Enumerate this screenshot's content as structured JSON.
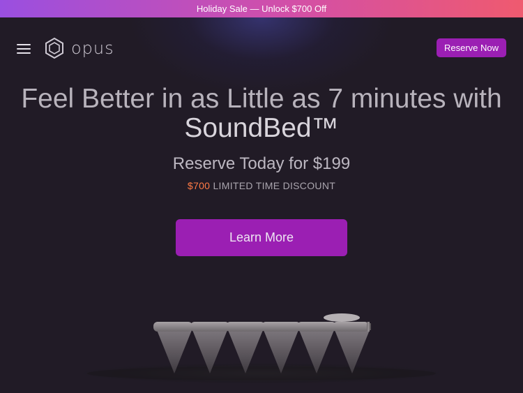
{
  "promo": {
    "text": "Holiday Sale — Unlock $700 Off"
  },
  "header": {
    "logo_text": "opus",
    "reserve_label": "Reserve Now"
  },
  "hero": {
    "headline_line1": "Feel Better in as Little as 7 minutes with",
    "headline_brand": "SoundBed™",
    "subhead": "Reserve Today for $199",
    "discount_price": "$700",
    "discount_text": " LIMITED TIME DISCOUNT",
    "cta_label": "Learn More"
  },
  "colors": {
    "accent": "#9b1fb3",
    "background": "#211b26",
    "discount_highlight": "#ff7a45"
  },
  "icons": [
    "menu-icon",
    "opus-hexagon-logo-icon"
  ]
}
